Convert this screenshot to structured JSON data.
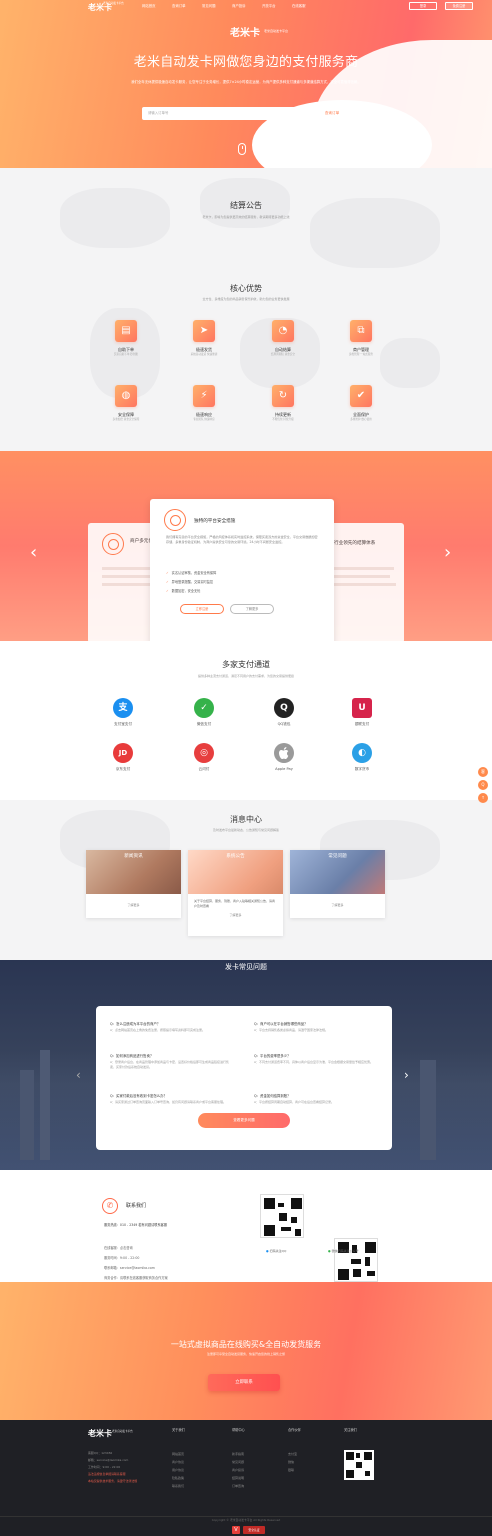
{
  "nav": {
    "logo": "老米卡",
    "logo_sub": "老米自动发卡平台",
    "items": [
      "网站首页",
      "查询订单",
      "常见问题",
      "商户投诉",
      "开放平台",
      "在线客服"
    ],
    "login": "登录",
    "register": "免费注册"
  },
  "hero": {
    "logo": "老米卡",
    "logo_sub": "老米自动发卡平台",
    "title": "老米自动发卡网做您身边的支付服务商",
    "desc": "我们全年无休提供极速自动发卡服务，让您专注于业务增长，提供7×24小时稳定运营，为商户提供多种支付通道与多渠道结算方式，安全可靠值得信赖。",
    "search_placeholder": "请输入订单号",
    "search_button": "查询订单"
  },
  "notice": {
    "title": "结算公告",
    "subtitle": "老米卡，即将为您提供更高效的结算服务，敬请期待更多功能上线"
  },
  "advantages": {
    "title": "核心优势",
    "subtitle": "全方位、多维度为您的商品销售保驾护航，助力您的业务更快发展",
    "items": [
      {
        "title": "自助下单",
        "desc": "买家自助下单 秒到账",
        "icon": "▤"
      },
      {
        "title": "极速发货",
        "desc": "系统自动发货 快速便捷",
        "icon": "➤"
      },
      {
        "title": "自动结算",
        "desc": "结算周期短 资金安全",
        "icon": "◔"
      },
      {
        "title": "商户管理",
        "desc": "多维管理 一站式服务",
        "icon": "⧉"
      },
      {
        "title": "安全保障",
        "desc": "多重加密 资金安全保障",
        "icon": "◍"
      },
      {
        "title": "极速响应",
        "desc": "专业团队 快速响应",
        "icon": "⚡"
      },
      {
        "title": "持续更新",
        "desc": "不断优化 持续升级",
        "icon": "↻"
      },
      {
        "title": "全面保护",
        "desc": "多重防护 放心使用",
        "icon": "✔"
      }
    ]
  },
  "carousel": {
    "left_title": "商户多元化服务",
    "right_title": "行业领先的结算体系",
    "card": {
      "title": "独特的平台安全措施",
      "text": "我们拥有完善的平台安全措施，严格的风控体系和实时监控系统，保障买卖双方的资金安全，平台交易数据加密存储，多重身份验证机制，为商户提供安全可靠的交易环境。24小时不间断安全监控。",
      "checks": [
        "实名认证审核，资金安全有保障",
        "异地登录提醒，交易实时监控",
        "数据加密，安全无忧"
      ],
      "btn1": "立即注册",
      "btn2": "了解更多"
    }
  },
  "payments": {
    "title": "多家支付通道",
    "subtitle": "提供多种主流支付通道，满足不同用户的支付需求，为您的交易提供便捷",
    "items": [
      {
        "label": "支付宝支付",
        "icon": "支",
        "color": "#1a8ff0"
      },
      {
        "label": "微信支付",
        "icon": "✓",
        "color": "#35b24a"
      },
      {
        "label": "QQ钱包",
        "icon": "Q",
        "color": "#222222"
      },
      {
        "label": "银联支付",
        "icon": "U",
        "color": "#d6244b"
      },
      {
        "label": "京东支付",
        "icon": "JD",
        "color": "#e83b3b"
      },
      {
        "label": "云闪付",
        "icon": "◎",
        "color": "#e73e3e"
      },
      {
        "label": "Apple Pay",
        "icon": "",
        "color": "#9a9a9a"
      },
      {
        "label": "数字货币",
        "icon": "◐",
        "color": "#2ba0e6"
      }
    ]
  },
  "news": {
    "title": "消息中心",
    "subtitle": "及时发布平台最新动态、公告通知与常见问题解答",
    "items": [
      {
        "title": "新闻资讯",
        "more": "了解更多",
        "text": ""
      },
      {
        "title": "系统公告",
        "more": "了解更多",
        "text": "关于平台结算、服务、到账、商户入驻等相关通知公告，请商户及时查看"
      },
      {
        "title": "常见问题",
        "more": "了解更多",
        "text": ""
      }
    ]
  },
  "faq": {
    "title": "发卡常见问题",
    "button": "查看更多问题",
    "items": [
      {
        "q": "Q：怎么注册成为本平台的商户？",
        "a": "A：点击网站首页右上角的免费注册，按照提示填写资料即可完成注册。"
      },
      {
        "q": "Q：商户可以在平台销售哪些商品？",
        "a": "A：平台支持销售各类虚拟商品，请遵守国家法律法规。"
      },
      {
        "q": "Q：如何添加商品进行售卖？",
        "a": "A：登录商户后台，在商品管理中添加商品与卡密，设置好价格后即可生成商品链接进行售卖，买家付款后系统自动发货。"
      },
      {
        "q": "Q：平台的费率是多少？",
        "a": "A：不同支付通道费率不同，具体以商户后台显示为准，平台会根据交易量给予相应优惠。"
      },
      {
        "q": "Q：买家付款后没有收到卡密怎么办？",
        "a": "A：请买家通过订单查询页面输入订单号查询，如仍有问题请联系商户或平台客服处理。"
      },
      {
        "q": "Q：资金如何结算到账？",
        "a": "A：平台按结算周期自动结算，商户可在后台查看结算记录。"
      }
    ]
  },
  "contact": {
    "title": "联系我们",
    "hotline": "服务热线：010 - 2349 若有问题请联系客服",
    "lines": [
      "在线客服：点击咨询",
      "服务时间：9:00 - 22:00",
      "联系邮箱：service@laomika.com",
      "商务合作：请联系在线客服获取商务合作方案"
    ],
    "qr1_label": "扫码关注QQ",
    "qr2_label": "微信扫码关注公众号"
  },
  "cta": {
    "title": "一站式虚拟商品在线购买&全自动发货服务",
    "subtitle": "注册即可享受全自动发货服务，快速开启您的线上销售之旅",
    "button": "立即联系"
  },
  "footer": {
    "logo": "老米卡",
    "logo_sub": "老米自动发卡平台",
    "columns": [
      {
        "title": "关于我们",
        "links": [
          "网站首页",
          "商户协议",
          "用户协议",
          "隐私政策",
          "联系我们"
        ]
      },
      {
        "title": "帮助中心",
        "links": [
          "新手指南",
          "常见问题",
          "商户投诉",
          "结算说明",
          "订单查询"
        ]
      },
      {
        "title": "合作伙伴",
        "links": [
          "支付宝",
          "微信",
          "银联"
        ]
      },
      {
        "title": "关注我们",
        "links": []
      }
    ],
    "info": [
      "客服QQ：123456",
      "邮箱：service@laomika.com",
      "工作时间：9:00 - 22:00",
      "违法违规信息举报请联系客服",
      "本站仅提供技术服务，请遵守法律法规"
    ],
    "copyright": "Copyright © 老米自动发卡平台 All Rights Reserved",
    "badge": "安全认证"
  },
  "side_buttons": [
    "客",
    "Q",
    "↑"
  ]
}
